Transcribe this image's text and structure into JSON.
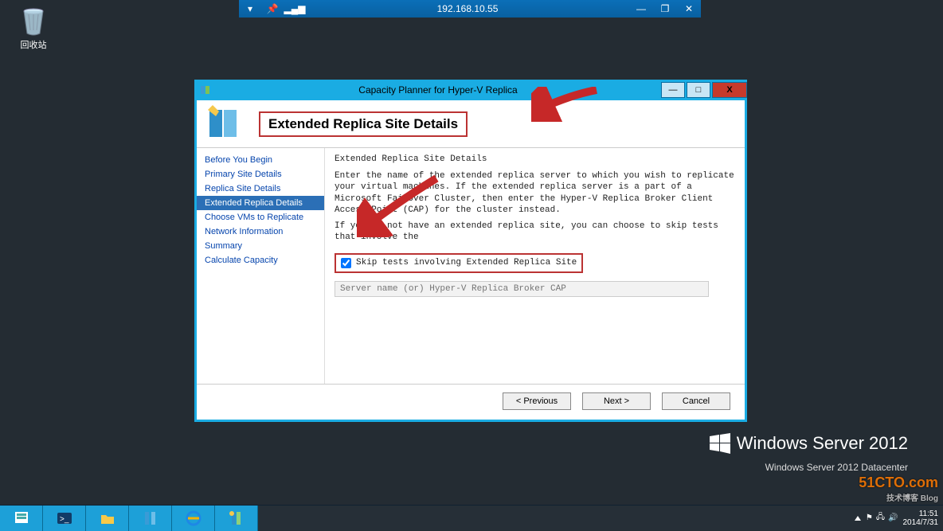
{
  "desktop": {
    "recycle_label": "回收站"
  },
  "remote": {
    "address": "192.168.10.55"
  },
  "window": {
    "title": "Capacity Planner for Hyper-V Replica",
    "heading": "Extended Replica Site Details",
    "nav": [
      "Before You Begin",
      "Primary Site Details",
      "Replica Site Details",
      "Extended Replica Details",
      "Choose VMs to Replicate",
      "Network Information",
      "Summary",
      "Calculate Capacity"
    ],
    "nav_selected_index": 3,
    "content": {
      "section_title": "Extended Replica Site Details",
      "para1": "Enter the name of the extended replica server to which you wish to replicate your virtual machines. If the extended replica server is a part of a Microsoft Failover Cluster, then enter the Hyper-V Replica Broker Client Access Point (CAP) for the cluster instead.",
      "para2": "If you do not have an extended replica site, you can choose to skip tests that involve the",
      "skip_label": "Skip tests involving Extended Replica Site",
      "skip_checked": true,
      "server_placeholder": "Server name (or) Hyper-V Replica Broker CAP"
    },
    "buttons": {
      "prev": "< Previous",
      "next": "Next >",
      "cancel": "Cancel"
    }
  },
  "brand": {
    "text": "Windows Server 2012",
    "edition": "Windows Server 2012 Datacenter"
  },
  "watermark": {
    "main": "51CTO.com",
    "sub": "技术博客 Blog"
  },
  "tray": {
    "time": "11:51",
    "date": "2014/7/31"
  }
}
